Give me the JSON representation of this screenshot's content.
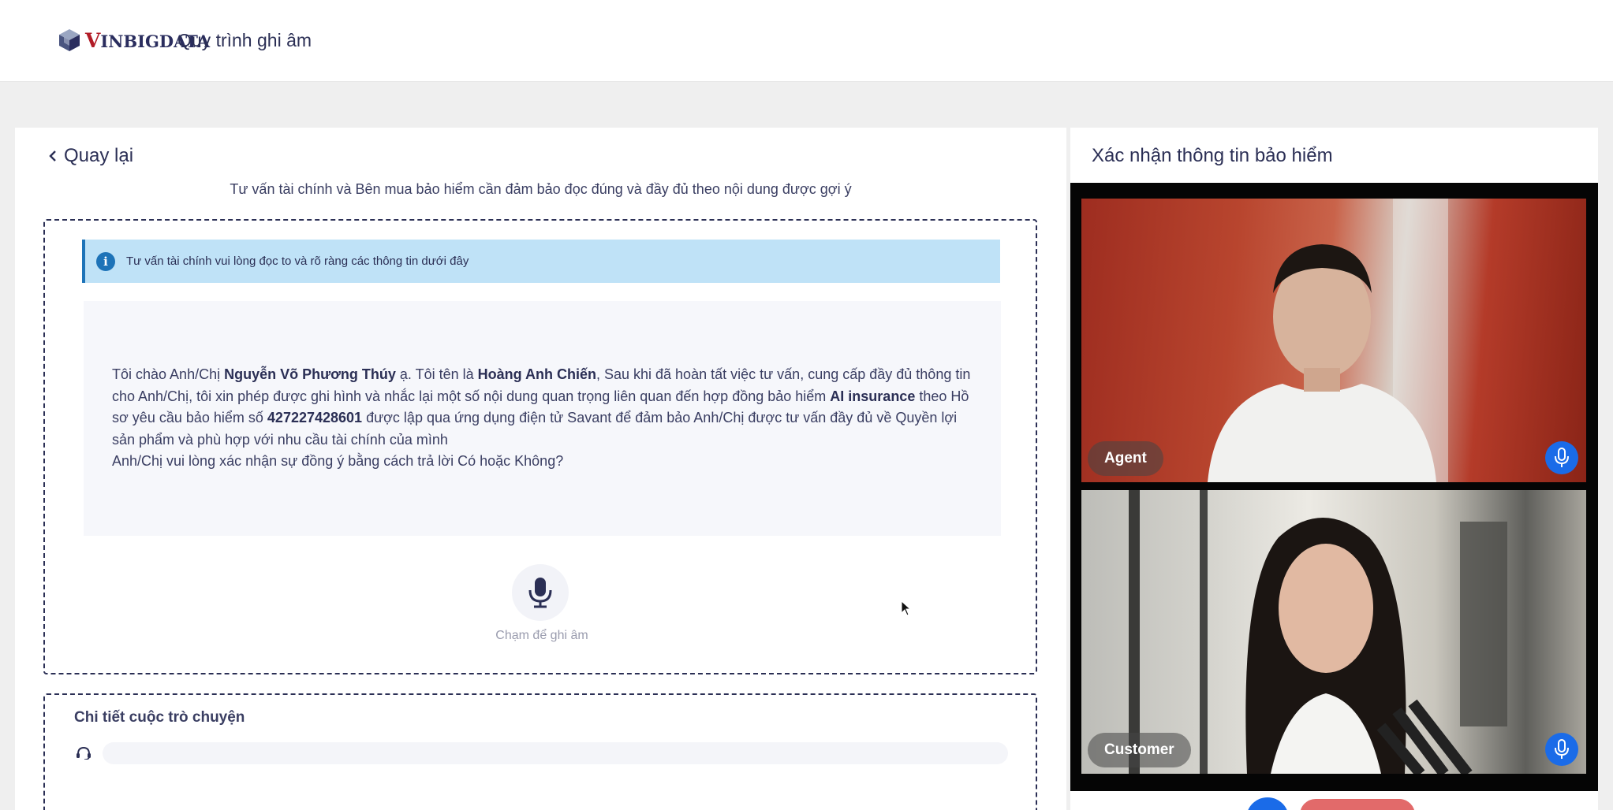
{
  "header": {
    "logo_text_first": "V",
    "logo_text_rest": "INBIGDATA",
    "app_title": "Quy trình ghi âm"
  },
  "left_panel": {
    "back_label": "Quay lại",
    "instruction": "Tư vấn tài chính và Bên mua bảo hiểm cần đảm bảo đọc đúng và đầy đủ theo nội dung được gợi ý",
    "info_banner": "Tư vấn tài chính vui lòng đọc to và rõ ràng các thông tin dưới đây",
    "script": {
      "greeting": "Tôi chào Anh/Chị ",
      "customer_name": "Nguyễn Võ Phương Thúy",
      "part2": " ạ. Tôi tên là ",
      "agent_name": "Hoàng Anh Chiến",
      "part3": ", Sau khi đã hoàn tất việc tư vấn, cung cấp đầy đủ thông tin cho Anh/Chị, tôi xin phép được ghi hình và nhắc lại một số nội dung quan trọng liên quan đến hợp đồng bảo hiểm ",
      "product": "AI insurance",
      "part4": " theo Hồ sơ yêu cầu bảo hiểm số ",
      "policy_number": "427227428601",
      "part5": " được lập qua ứng dụng điện tử Savant để đảm bảo Anh/Chị được tư vấn đầy đủ về Quyền lợi sản phẩm và phù hợp với nhu cầu tài chính của mình",
      "question": "Anh/Chị vui lòng xác nhận sự đồng ý bằng cách trả lời Có hoặc Không?"
    },
    "mic_label": "Chạm để ghi âm",
    "chat_title": "Chi tiết cuộc trò chuyện"
  },
  "right_panel": {
    "title": "Xác nhận thông tin bảo hiểm",
    "agent_label": "Agent",
    "customer_label": "Customer"
  },
  "colors": {
    "primary_text": "#2b2f55",
    "info_banner_bg": "#bfe2f7",
    "info_accent": "#1d73b8",
    "mic_blue": "#1a6be8",
    "end_call_red": "#e26a6a",
    "logo_red": "#b21c27"
  }
}
